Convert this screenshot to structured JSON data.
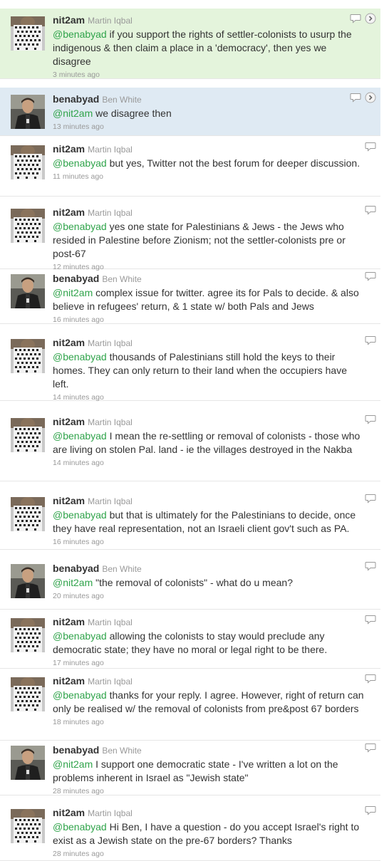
{
  "tweets": [
    {
      "user": "nit2am",
      "full": "Martin Iqbal",
      "mention": "@benabyad",
      "text": " if you support the rights of settler-colonists to usurp the indigenous & then claim a place in a 'democracy', then yes we disagree",
      "time": "3 minutes ago"
    },
    {
      "user": "benabyad",
      "full": "Ben White",
      "mention": "@nit2am",
      "text": " we disagree then",
      "time": "13 minutes ago"
    },
    {
      "user": "nit2am",
      "full": "Martin Iqbal",
      "mention": "@benabyad",
      "text": " but yes, Twitter not the best forum for deeper discussion.",
      "time": "11 minutes ago"
    },
    {
      "user": "nit2am",
      "full": "Martin Iqbal",
      "mention": "@benabyad",
      "text": " yes one state for Palestinians & Jews - the Jews who resided in Palestine before Zionism; not the settler-colonists pre or post-67",
      "time": "12 minutes ago"
    },
    {
      "user": "benabyad",
      "full": "Ben White",
      "mention": "@nit2am",
      "text": " complex issue for twitter. agree its for Pals to decide. & also believe in refugees' return, & 1 state w/ both Pals and Jews",
      "time": "16 minutes ago"
    },
    {
      "user": "nit2am",
      "full": "Martin Iqbal",
      "mention": "@benabyad",
      "text": " thousands of Palestinians still hold the keys to their homes. They can only return to their land when the occupiers have left.",
      "time": "14 minutes ago"
    },
    {
      "user": "nit2am",
      "full": "Martin Iqbal",
      "mention": "@benabyad",
      "text": " I mean the re-settling or removal of colonists - those who are living on stolen Pal. land - ie the villages destroyed in the Nakba",
      "time": "14 minutes ago"
    },
    {
      "user": "nit2am",
      "full": "Martin Iqbal",
      "mention": "@benabyad",
      "text": " but that is ultimately for the Palestinians to decide, once they have real representation, not an Israeli client gov't such as PA.",
      "time": "16 minutes ago"
    },
    {
      "user": "benabyad",
      "full": "Ben White",
      "mention": "@nit2am",
      "text": " \"the removal of colonists\" - what do u mean?",
      "time": "20 minutes ago"
    },
    {
      "user": "nit2am",
      "full": "Martin Iqbal",
      "mention": "@benabyad",
      "text": " allowing the colonists to stay would preclude any democratic state; they have no moral or legal right to be there.",
      "time": "17 minutes ago"
    },
    {
      "user": "nit2am",
      "full": "Martin Iqbal",
      "mention": "@benabyad",
      "text": " thanks for your reply. I agree. However, right of return can only be realised w/ the removal of colonists from pre&post 67 borders",
      "time": "18 minutes ago"
    },
    {
      "user": "benabyad",
      "full": "Ben White",
      "mention": "@nit2am",
      "text": " I support one democratic state - I've written a lot on the problems inherent in Israel as \"Jewish state\"",
      "time": "28 minutes ago"
    },
    {
      "user": "nit2am",
      "full": "Martin Iqbal",
      "mention": "@benabyad",
      "text": " Hi Ben, I have a question - do you accept Israel's right to exist as a Jewish state on the pre-67 borders? Thanks",
      "time": "28 minutes ago"
    }
  ],
  "colors": {
    "mention": "#2fa34a",
    "highlight_green": "#e4f4dc",
    "highlight_blue": "#dfeaf3"
  },
  "icons": {
    "reply": "reply-icon",
    "more": "chevron-right-icon",
    "avatar_nit2am": "keffiyeh-avatar",
    "avatar_benabyad": "portrait-avatar"
  }
}
